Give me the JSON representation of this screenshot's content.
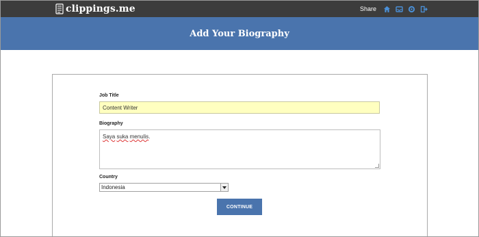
{
  "app": {
    "logo_text": "clippings.me"
  },
  "nav": {
    "share_label": "Share",
    "icons": [
      "home-icon",
      "inbox-icon",
      "settings-icon",
      "logout-icon"
    ]
  },
  "header": {
    "title": "Add Your Biography"
  },
  "form": {
    "job_title": {
      "label": "Job Title",
      "value": "Content Writer"
    },
    "biography": {
      "label": "Biography",
      "value_word1": "Saya",
      "value_word2": "suka",
      "value_word3": "menulis",
      "value_end": "."
    },
    "country": {
      "label": "Country",
      "selected": "Indonesia"
    },
    "continue_label": "CONTINUE"
  },
  "colors": {
    "topbar": "#3c3c3c",
    "accent": "#4a74ad",
    "highlight_input": "#ffffc0"
  }
}
